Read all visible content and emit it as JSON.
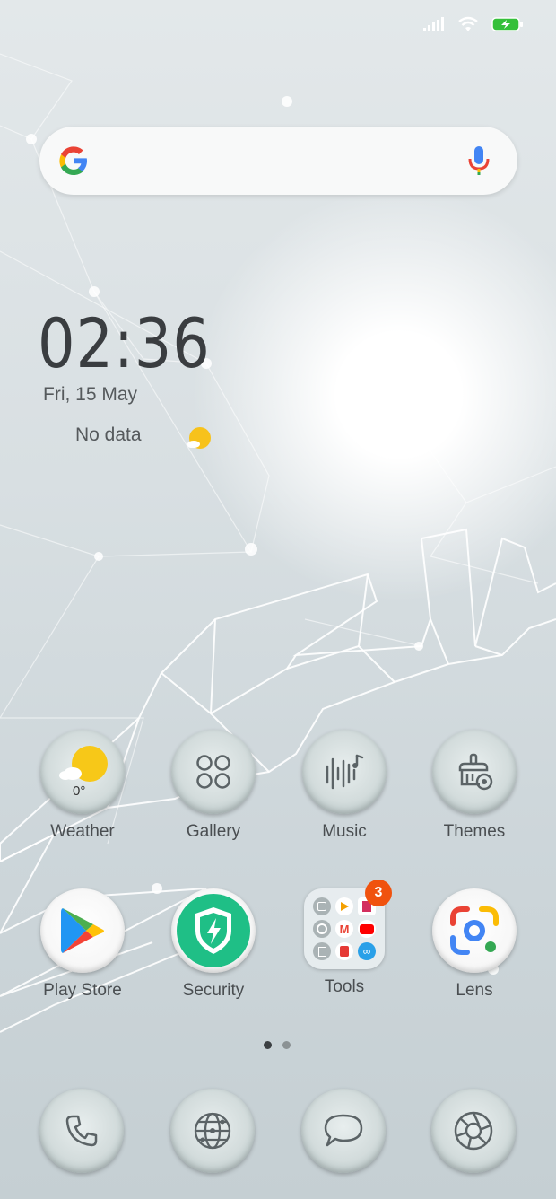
{
  "status": {
    "signal_icon": "signal-icon",
    "wifi_icon": "wifi-icon",
    "battery_icon": "battery-charging-icon",
    "battery_color": "#35c03a"
  },
  "search": {
    "logo_icon": "google-logo-icon",
    "mic_icon": "microphone-icon"
  },
  "clock": {
    "time": "02:36",
    "date": "Fri, 15 May",
    "weather_text": "No data",
    "weather_icon": "sun-cloud-icon"
  },
  "apps_row1": [
    {
      "label": "Weather",
      "icon": "weather-icon",
      "temp": "0°"
    },
    {
      "label": "Gallery",
      "icon": "gallery-icon"
    },
    {
      "label": "Music",
      "icon": "music-icon"
    },
    {
      "label": "Themes",
      "icon": "themes-icon"
    }
  ],
  "apps_row2": [
    {
      "label": "Play Store",
      "icon": "play-store-icon"
    },
    {
      "label": "Security",
      "icon": "security-shield-icon"
    },
    {
      "label": "Tools",
      "icon": "folder-icon",
      "badge": "3"
    },
    {
      "label": "Lens",
      "icon": "google-lens-icon"
    }
  ],
  "pages": {
    "count": 2,
    "active": 1
  },
  "dock": [
    {
      "icon": "phone-icon"
    },
    {
      "icon": "browser-globe-icon"
    },
    {
      "icon": "messages-icon"
    },
    {
      "icon": "camera-icon"
    }
  ],
  "colors": {
    "accent_badge": "#f0520e",
    "security_green": "#1fbf86",
    "text": "#4a4e51"
  }
}
